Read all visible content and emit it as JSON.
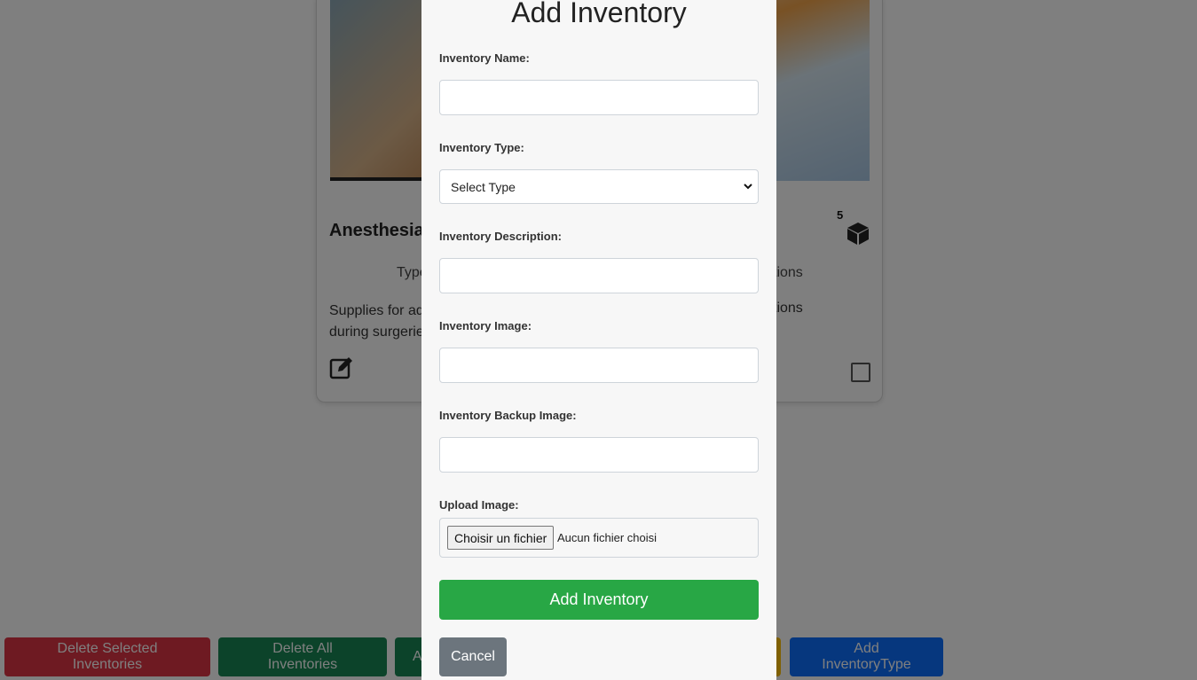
{
  "background": {
    "card": {
      "title": "Anesthesia",
      "count": "5",
      "type_text": "Type",
      "type_text_right": "tions",
      "description": "Supplies for ad",
      "description_line2": "during surgerie",
      "description_right": "tions"
    },
    "buttons": {
      "delete_selected": "Delete Selected Inventories",
      "delete_all": "Delete All Inventories",
      "add_inventory_partial": "A",
      "add_inventory_type": "Add InventoryType"
    }
  },
  "modal": {
    "title": "Add Inventory",
    "name_label": "Inventory Name:",
    "name_value": "",
    "type_label": "Inventory Type:",
    "type_selected": "Select Type",
    "description_label": "Inventory Description:",
    "description_value": "",
    "image_label": "Inventory Image:",
    "image_value": "",
    "backup_image_label": "Inventory Backup Image:",
    "backup_image_value": "",
    "upload_label": "Upload Image:",
    "file_button": "Choisir un fichier",
    "file_status": "Aucun fichier choisi",
    "submit": "Add Inventory",
    "cancel": "Cancel"
  },
  "colors": {
    "success": "#28a745",
    "secondary": "#6c757d",
    "danger": "#dc3545",
    "dark_green": "#198754",
    "primary": "#0d6efd",
    "warning": "#ffc107"
  },
  "icons": [
    "box-icon",
    "edit-icon",
    "chevron-down-icon"
  ]
}
